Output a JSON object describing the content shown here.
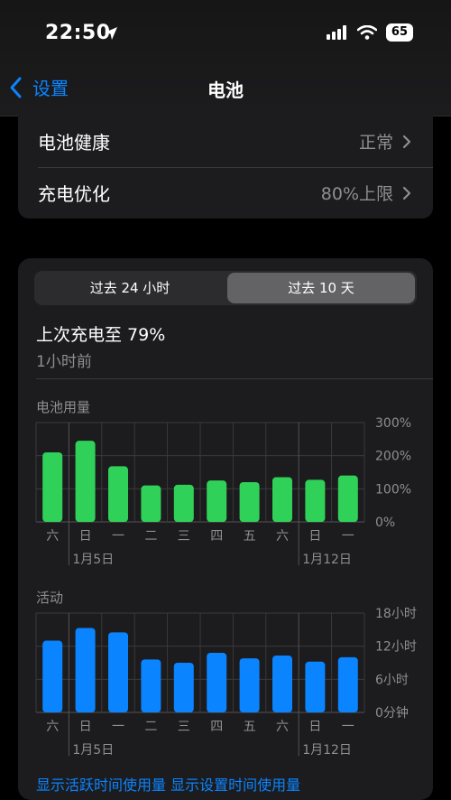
{
  "status_bar": {
    "time": "22:50",
    "battery": "65"
  },
  "nav": {
    "back_label": "设置",
    "title": "电池"
  },
  "settings_rows": [
    {
      "label": "电池健康",
      "value": "正常"
    },
    {
      "label": "充电优化",
      "value": "80%上限"
    }
  ],
  "segmented": {
    "options": [
      "过去 24 小时",
      "过去 10 天"
    ],
    "selected_index": 1
  },
  "last_charge": {
    "title": "上次充电至 79%",
    "subtitle": "1小时前"
  },
  "chart_data": [
    {
      "type": "bar",
      "title": "电池用量",
      "categories": [
        "六",
        "日",
        "一",
        "二",
        "三",
        "四",
        "五",
        "六",
        "日",
        "一"
      ],
      "date_labels": [
        "1月5日",
        "1月12日"
      ],
      "y_tick_labels": [
        "300%",
        "200%",
        "100%",
        "0%"
      ],
      "ylim": [
        0,
        300
      ],
      "values": [
        210,
        245,
        168,
        110,
        112,
        125,
        120,
        135,
        127,
        140
      ],
      "color": "#30d158"
    },
    {
      "type": "bar",
      "title": "活动",
      "categories": [
        "六",
        "日",
        "一",
        "二",
        "三",
        "四",
        "五",
        "六",
        "日",
        "一"
      ],
      "date_labels": [
        "1月5日",
        "1月12日"
      ],
      "y_tick_labels": [
        "18小时",
        "12小时",
        "6小时",
        "0分钟"
      ],
      "ylim": [
        0,
        18
      ],
      "values": [
        13.0,
        15.3,
        14.5,
        9.6,
        9.0,
        10.8,
        9.8,
        10.3,
        9.2,
        10.0
      ],
      "color": "#0a84ff"
    }
  ],
  "bottom_links": "显示活跃时间使用量    显示设置时间使用量"
}
